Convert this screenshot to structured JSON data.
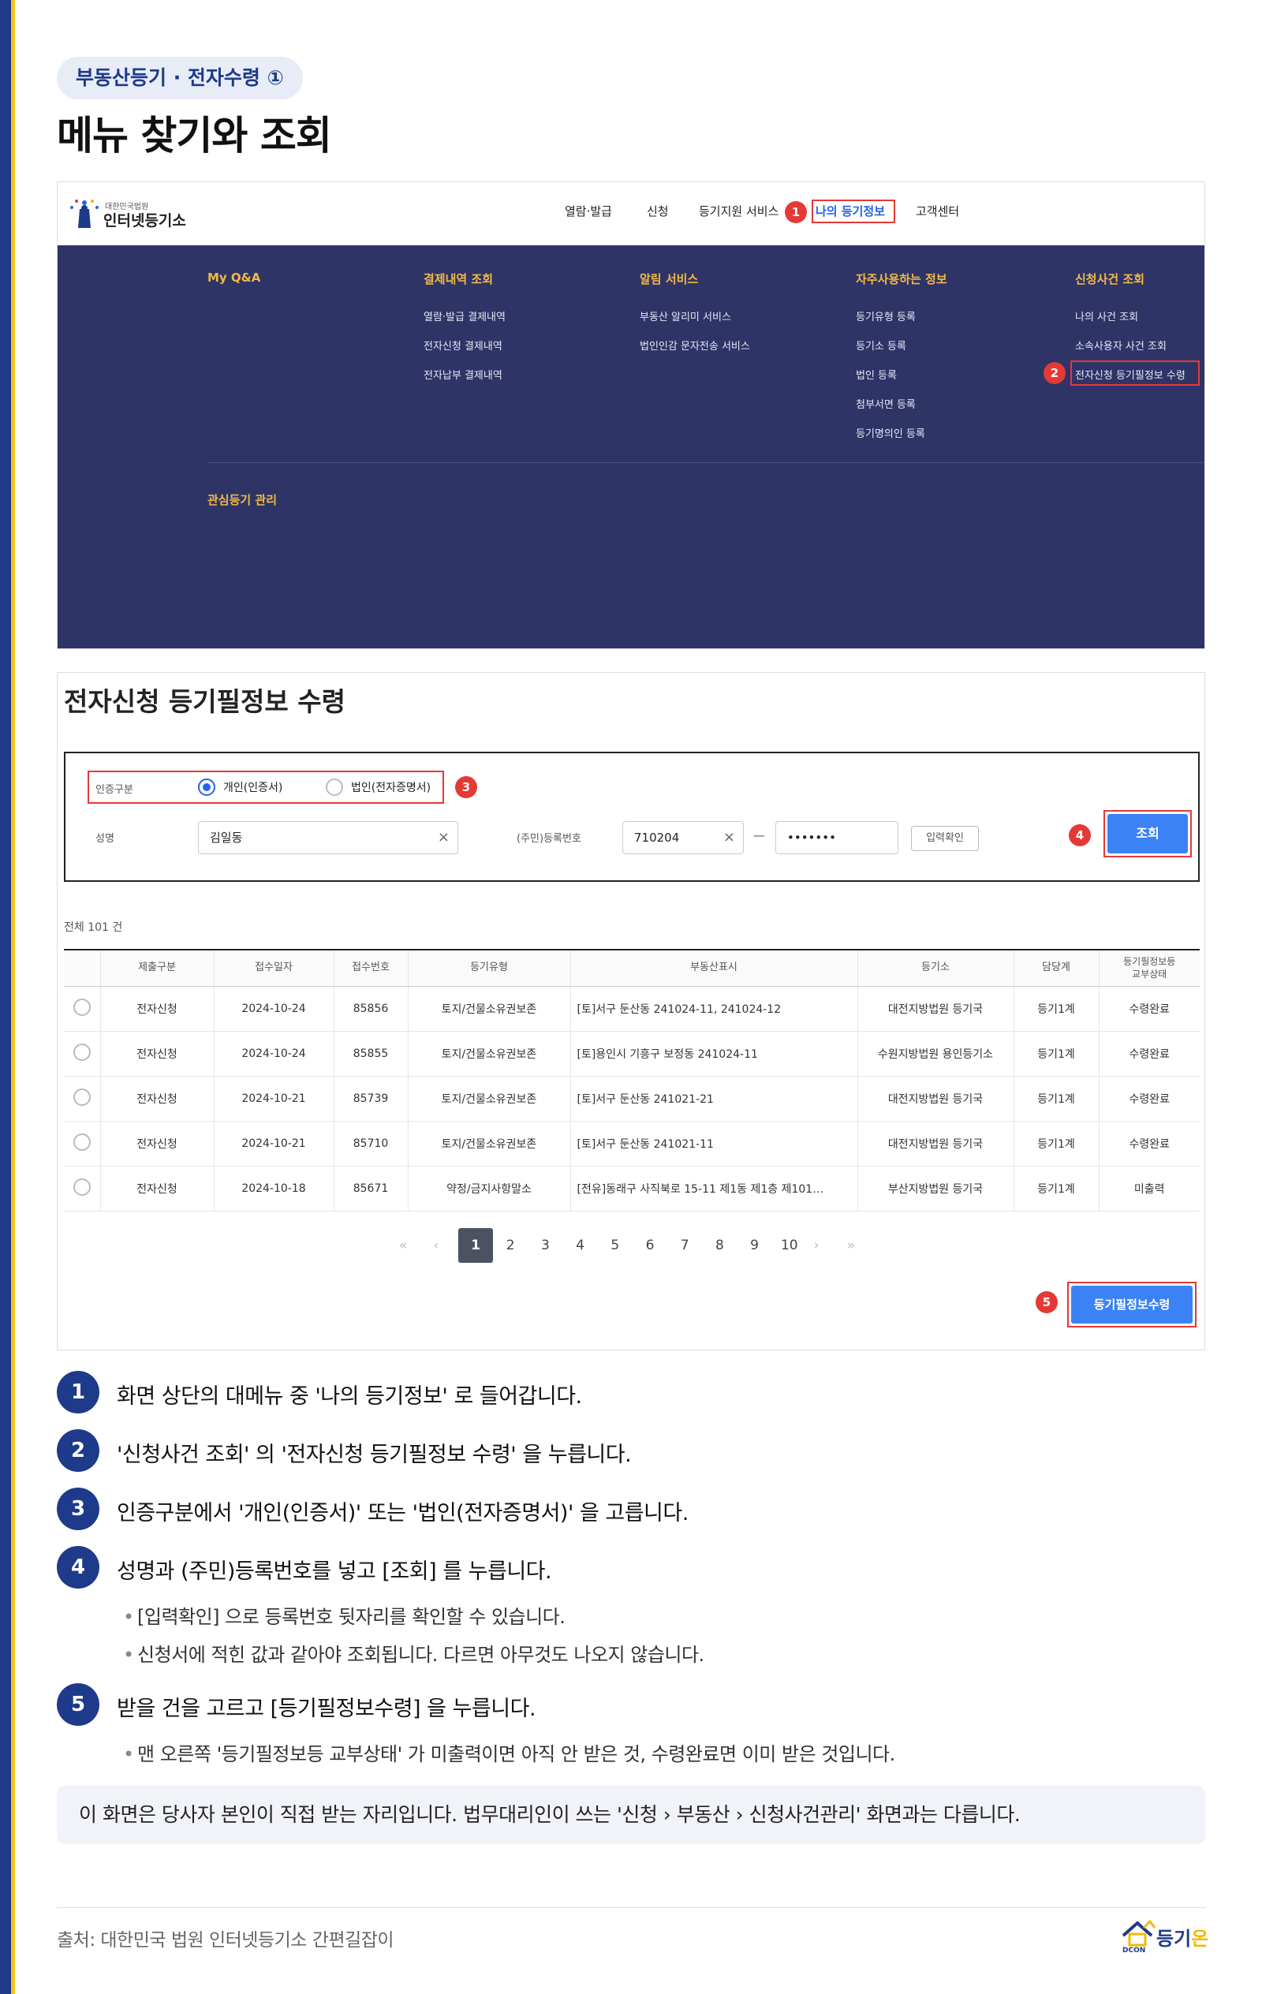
{
  "header": {
    "pill": "부동산등기 · 전자수령 ①",
    "title": "메뉴 찾기와 조회"
  },
  "site": {
    "logo_small": "대한민국법원",
    "logo_big": "인터넷등기소",
    "nav": [
      "열람·발급",
      "신청",
      "등기지원 서비스",
      "나의 등기정보",
      "고객센터"
    ],
    "active_nav": "나의 등기정보"
  },
  "megamenu": {
    "columns": [
      {
        "head": "My Q&A",
        "items": []
      },
      {
        "head": "결제내역 조회",
        "items": [
          "열람·발급 결제내역",
          "전자신청 결제내역",
          "전자납부 결제내역"
        ]
      },
      {
        "head": "알림 서비스",
        "items": [
          "부동산 알리미 서비스",
          "법인인감 문자전송 서비스"
        ]
      },
      {
        "head": "자주사용하는 정보",
        "items": [
          "등기유형 등록",
          "등기소 등록",
          "법인 등록",
          "첨부서면 등록",
          "등기명의인 등록"
        ]
      },
      {
        "head": "신청사건 조회",
        "items": [
          "나의 사건 조회",
          "소속사용자 사건 조회",
          "전자신청 등기필정보 수령"
        ]
      }
    ],
    "bottom_head": "관심등기 관리"
  },
  "form": {
    "page_title": "전자신청 등기필정보 수령",
    "auth_label": "인증구분",
    "auth_options": [
      "개인(인증서)",
      "법인(전자증명서)"
    ],
    "auth_selected": "개인(인증서)",
    "name_label": "성명",
    "name_value": "김일동",
    "id_label": "(주민)등록번호",
    "id_front": "710204",
    "id_dash": "—",
    "id_back": "•••••••",
    "check_button": "입력확인",
    "search_button": "조회",
    "clear_icon": "×"
  },
  "results": {
    "total": "전체 101 건",
    "columns": [
      "제출구분",
      "접수일자",
      "접수번호",
      "등기유형",
      "부동산표시",
      "등기소",
      "담당계",
      "등기필정보등\n교부상태"
    ],
    "rows": [
      [
        "전자신청",
        "2024-10-24",
        "85856",
        "토지/건물소유권보존",
        "[토]서구 둔산동 241024-11, 241024-12",
        "대전지방법원 등기국",
        "등기1계",
        "수령완료"
      ],
      [
        "전자신청",
        "2024-10-24",
        "85855",
        "토지/건물소유권보존",
        "[토]용인시 기흥구 보정동 241024-11",
        "수원지방법원 용인등기소",
        "등기1계",
        "수령완료"
      ],
      [
        "전자신청",
        "2024-10-21",
        "85739",
        "토지/건물소유권보존",
        "[토]서구 둔산동 241021-21",
        "대전지방법원 등기국",
        "등기1계",
        "수령완료"
      ],
      [
        "전자신청",
        "2024-10-21",
        "85710",
        "토지/건물소유권보존",
        "[토]서구 둔산동 241021-11",
        "대전지방법원 등기국",
        "등기1계",
        "수령완료"
      ],
      [
        "전자신청",
        "2024-10-18",
        "85671",
        "약정/금지사항말소",
        "[전유]동래구 사직북로 15-11 제1동 제1층 제101…",
        "부산지방법원 등기국",
        "등기1계",
        "미출력"
      ]
    ],
    "pages": [
      "1",
      "2",
      "3",
      "4",
      "5",
      "6",
      "7",
      "8",
      "9",
      "10"
    ],
    "current_page": "1",
    "pager_first": "«",
    "pager_prev": "‹",
    "pager_next": "›",
    "pager_last": "»",
    "receive_button": "등기필정보수령"
  },
  "markers": [
    "1",
    "2",
    "3",
    "4",
    "5"
  ],
  "steps": [
    {
      "num": "1",
      "text": "화면 상단의 대메뉴 중 '나의 등기정보' 로 들어갑니다.",
      "bullets": []
    },
    {
      "num": "2",
      "text": "'신청사건 조회' 의 '전자신청 등기필정보 수령' 을 누릅니다.",
      "bullets": []
    },
    {
      "num": "3",
      "text": "인증구분에서 '개인(인증서)' 또는 '법인(전자증명서)' 을 고릅니다.",
      "bullets": []
    },
    {
      "num": "4",
      "text": "성명과 (주민)등록번호를 넣고 [조회] 를 누릅니다.",
      "bullets": [
        "[입력확인] 으로 등록번호 뒷자리를 확인할 수 있습니다.",
        "신청서에 적힌 값과 같아야 조회됩니다. 다르면 아무것도 나오지 않습니다."
      ]
    },
    {
      "num": "5",
      "text": "받을 건을 고르고 [등기필정보수령] 을 누릅니다.",
      "bullets": [
        "맨 오른쪽 '등기필정보등 교부상태' 가 미출력이면 아직 안 받은 것, 수령완료면 이미 받은 것입니다."
      ]
    }
  ],
  "note": "이 화면은 당사자 본인이 직접 받는 자리입니다. 법무대리인이 쓰는 '신청 › 부동산 › 신청사건관리' 화면과는 다릅니다.",
  "footer": {
    "source": "출처: 대한민국 법원 인터넷등기소 간편길잡이",
    "brand_a": "등기",
    "brand_b": "온",
    "brand_sub": "DCON"
  },
  "colors": {
    "navy": "#1e3a8a",
    "menu_bg": "#2e3466",
    "accent_red": "#e53935",
    "button_blue": "#3b82f6",
    "menu_head": "#f5b942"
  }
}
